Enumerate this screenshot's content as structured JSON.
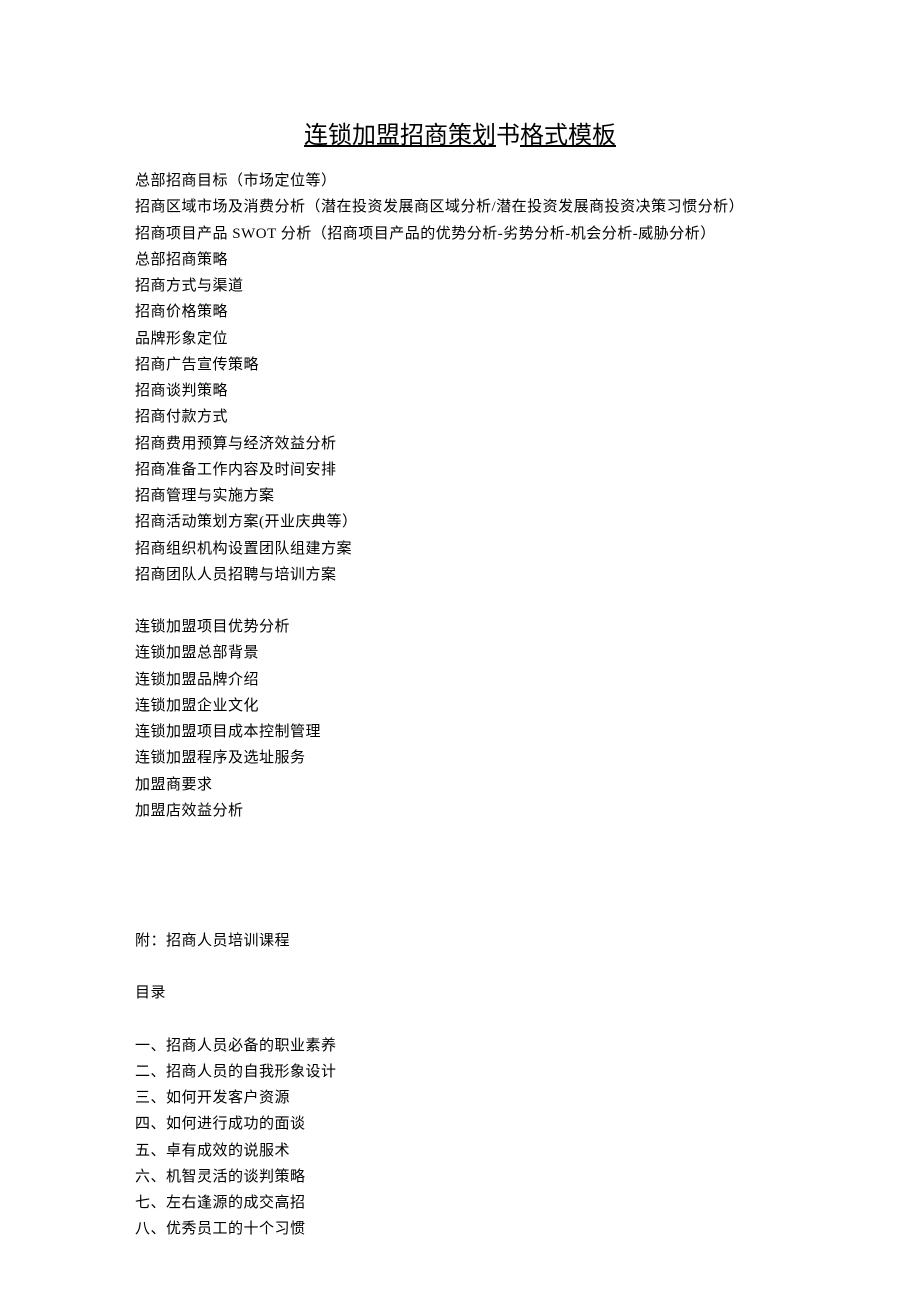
{
  "title": {
    "part1": "连锁加盟招商策划",
    "part2": "书",
    "part3": "格式模板"
  },
  "section1": [
    "总部招商目标（市场定位等）",
    "招商区域市场及消费分析（潜在投资发展商区域分析/潜在投资发展商投资决策习惯分析）",
    "招商项目产品 SWOT 分析（招商项目产品的优势分析-劣势分析-机会分析-威胁分析）",
    "总部招商策略",
    "招商方式与渠道",
    "招商价格策略",
    "品牌形象定位",
    "招商广告宣传策略",
    "招商谈判策略",
    "招商付款方式",
    "招商费用预算与经济效益分析",
    "招商准备工作内容及时间安排",
    "招商管理与实施方案",
    "招商活动策划方案(开业庆典等）",
    "招商组织机构设置团队组建方案",
    "招商团队人员招聘与培训方案"
  ],
  "section2": [
    "连锁加盟项目优势分析",
    "连锁加盟总部背景",
    "连锁加盟品牌介绍",
    "连锁加盟企业文化",
    "连锁加盟项目成本控制管理",
    "连锁加盟程序及选址服务",
    "加盟商要求",
    "加盟店效益分析"
  ],
  "appendix": {
    "title": "附：招商人员培训课程",
    "toc_label": "目录",
    "items": [
      "一、招商人员必备的职业素养",
      "二、招商人员的自我形象设计",
      "三、如何开发客户资源",
      "四、如何进行成功的面谈",
      "五、卓有成效的说服术",
      "六、机智灵活的谈判策略",
      "七、左右逢源的成交高招",
      "八、优秀员工的十个习惯"
    ]
  }
}
